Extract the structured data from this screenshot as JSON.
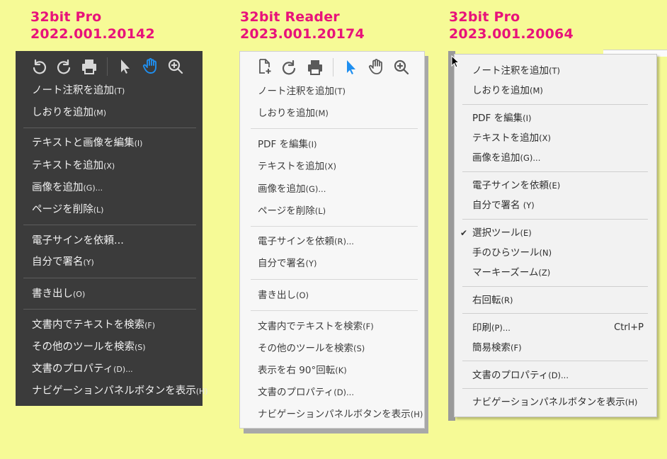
{
  "headings": [
    {
      "line1": "32bit Pro",
      "line2": "2022.001.20142"
    },
    {
      "line1": "32bit Reader",
      "line2": "2023.001.20174"
    },
    {
      "line1": "32bit Pro",
      "line2": "2023.001.20064"
    }
  ],
  "colors": {
    "background": "#f6fa96",
    "heading": "#e8127a",
    "panel1_bg": "#3b3b3b",
    "panel2_bg": "#f7f7f7",
    "panel3_bg": "#f2f2f2",
    "active_tool_blue": "#1f8ff0"
  },
  "panel1": {
    "toolbar": [
      "rotate-ccw-icon",
      "rotate-cw-icon",
      "print-icon",
      "select-arrow-icon",
      "hand-icon",
      "zoom-in-icon"
    ],
    "items": [
      {
        "label": "ノート注釈を追加",
        "acc": "(T)"
      },
      {
        "label": "しおりを追加",
        "acc": "(M)"
      },
      {
        "label": "テキストと画像を編集",
        "acc": "(I)"
      },
      {
        "label": "テキストを追加",
        "acc": "(X)"
      },
      {
        "label": "画像を追加",
        "acc": "(G)..."
      },
      {
        "label": "ページを削除",
        "acc": "(L)"
      },
      {
        "label": "電子サインを依頼...",
        "acc": ""
      },
      {
        "label": "自分で署名",
        "acc": "(Y)"
      },
      {
        "label": "書き出し",
        "acc": "(O)"
      },
      {
        "label": "文書内でテキストを検索",
        "acc": "(F)"
      },
      {
        "label": "その他のツールを検索",
        "acc": "(S)"
      },
      {
        "label": "文書のプロパティ",
        "acc": "(D)..."
      },
      {
        "label": "ナビゲーションパネルボタンを表示",
        "acc": "(H)"
      }
    ]
  },
  "panel2": {
    "toolbar": [
      "add-page-icon",
      "rotate-cw-icon",
      "print-icon",
      "select-arrow-icon",
      "hand-icon",
      "zoom-in-icon"
    ],
    "items": [
      {
        "label": "ノート注釈を追加",
        "acc": "(T)"
      },
      {
        "label": "しおりを追加",
        "acc": "(M)"
      },
      {
        "label": "PDF を編集",
        "acc": "(I)"
      },
      {
        "label": "テキストを追加",
        "acc": "(X)"
      },
      {
        "label": "画像を追加",
        "acc": "(G)..."
      },
      {
        "label": "ページを削除",
        "acc": "(L)"
      },
      {
        "label": "電子サインを依頼",
        "acc": "(R)..."
      },
      {
        "label": "自分で署名",
        "acc": "(Y)"
      },
      {
        "label": "書き出し",
        "acc": "(O)"
      },
      {
        "label": "文書内でテキストを検索",
        "acc": "(F)"
      },
      {
        "label": "その他のツールを検索",
        "acc": "(S)"
      },
      {
        "label": "表示を右 90°回転",
        "acc": "(K)"
      },
      {
        "label": "文書のプロパティ",
        "acc": "(D)..."
      },
      {
        "label": "ナビゲーションパネルボタンを表示",
        "acc": "(H)"
      }
    ]
  },
  "panel3": {
    "items": [
      {
        "label": "ノート注釈を追加",
        "acc": "(T)"
      },
      {
        "label": "しおりを追加",
        "acc": "(M)"
      },
      {
        "label": "PDF を編集",
        "acc": "(I)"
      },
      {
        "label": "テキストを追加",
        "acc": "(X)"
      },
      {
        "label": "画像を追加",
        "acc": "(G)..."
      },
      {
        "label": "電子サインを依頼",
        "acc": "(E)"
      },
      {
        "label": "自分で署名 ",
        "acc": "(Y)"
      },
      {
        "label": "選択ツール",
        "acc": "(E)",
        "checked": true
      },
      {
        "label": "手のひらツール",
        "acc": "(N)"
      },
      {
        "label": "マーキーズーム",
        "acc": "(Z)"
      },
      {
        "label": "右回転",
        "acc": "(R)"
      },
      {
        "label": "印刷",
        "acc": "(P)...",
        "shortcut": "Ctrl+P"
      },
      {
        "label": "簡易検索",
        "acc": "(F)"
      },
      {
        "label": "文書のプロパティ",
        "acc": "(D)..."
      },
      {
        "label": "ナビゲーションパネルボタンを表示",
        "acc": "(H)"
      }
    ]
  }
}
